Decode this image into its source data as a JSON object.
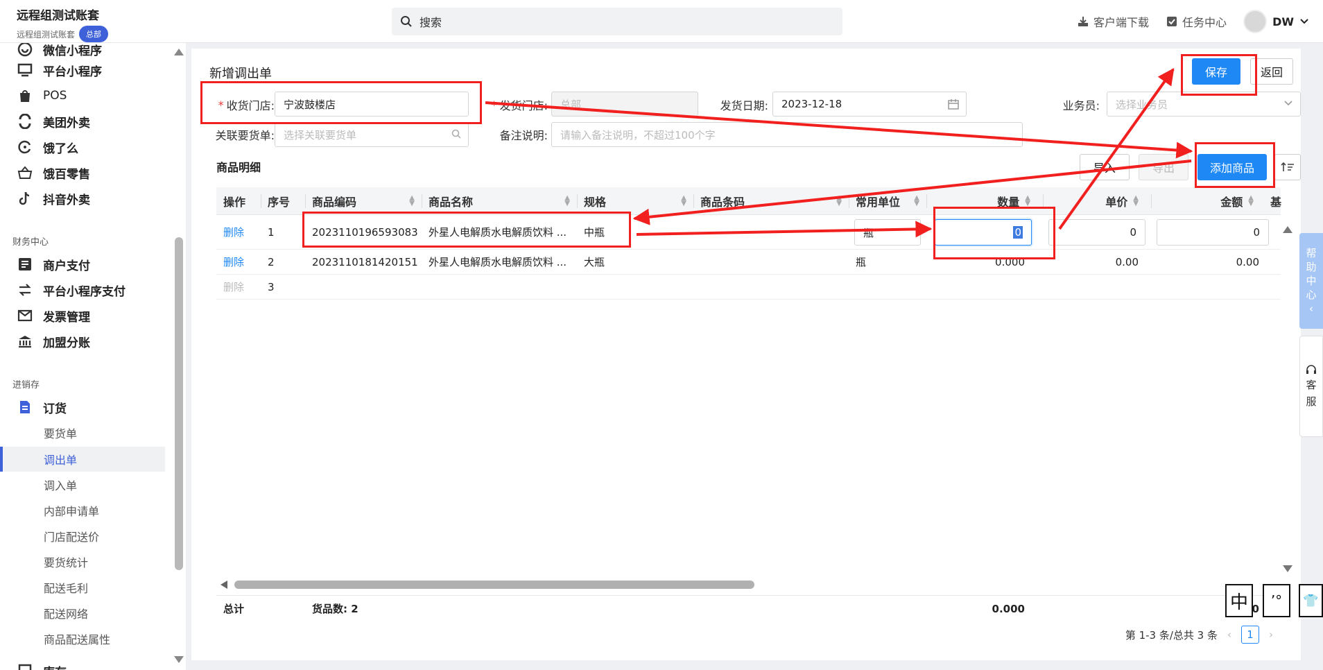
{
  "header": {
    "brand_title": "远程组测试账套",
    "brand_sub": "远程组测试账套",
    "brand_badge": "总部",
    "search_placeholder": "搜索",
    "client_download": "客户端下载",
    "task_center": "任务中心",
    "user": "DW"
  },
  "sidebar": {
    "top_items": [
      {
        "label": "微信小程序",
        "icon": "wechat-miniapp-icon"
      },
      {
        "label": "平台小程序",
        "icon": "platform-miniapp-icon"
      },
      {
        "label": "POS",
        "icon": "pos-bag-icon"
      },
      {
        "label": "美团外卖",
        "icon": "meituan-icon"
      },
      {
        "label": "饿了么",
        "icon": "eleme-icon"
      },
      {
        "label": "饿百零售",
        "icon": "basket-icon"
      },
      {
        "label": "抖音外卖",
        "icon": "douyin-icon"
      }
    ],
    "finance_label": "财务中心",
    "finance_items": [
      {
        "label": "商户支付",
        "icon": "list-icon"
      },
      {
        "label": "平台小程序支付",
        "icon": "exchange-icon"
      },
      {
        "label": "发票管理",
        "icon": "invoice-icon"
      },
      {
        "label": "加盟分账",
        "icon": "bank-icon"
      }
    ],
    "inventory_label": "进销存",
    "order_group": "订货",
    "order_items": [
      "要货单",
      "调出单",
      "调入单",
      "内部申请单",
      "门店配送价",
      "要货统计",
      "配送毛利",
      "配送网络",
      "商品配送属性"
    ],
    "active_item": "调出单",
    "bottom_item": "库存"
  },
  "page": {
    "title": "新增调出单",
    "save": "保存",
    "back": "返回",
    "form": {
      "receive_store_label": "收货门店:",
      "receive_store_value": "宁波鼓楼店",
      "send_store_label": "发货门店:",
      "send_store_value": "总部",
      "send_date_label": "发货日期:",
      "send_date_value": "2023-12-18",
      "salesman_label": "业务员:",
      "salesman_placeholder": "选择业务员",
      "related_order_label": "关联要货单:",
      "related_order_placeholder": "选择关联要货单",
      "remark_label": "备注说明:",
      "remark_placeholder": "请输入备注说明，不超过100个字"
    },
    "detail_title": "商品明细",
    "import": "导入",
    "export": "导出",
    "add_goods": "添加商品",
    "columns": [
      "操作",
      "序号",
      "商品编码",
      "商品名称",
      "规格",
      "商品条码",
      "常用单位",
      "数量",
      "单价",
      "金额",
      "基"
    ],
    "rows": [
      {
        "action": "删除",
        "no": "1",
        "code": "2023110196593083",
        "name": "外星人电解质水电解质饮料 ...",
        "spec": "中瓶",
        "barcode": "",
        "unit": "瓶",
        "qty": "0",
        "price": "0",
        "amount": "0"
      },
      {
        "action": "删除",
        "no": "2",
        "code": "2023110181420151",
        "name": "外星人电解质水电解质饮料 ...",
        "spec": "大瓶",
        "barcode": "",
        "unit": "瓶",
        "qty": "0.000",
        "price": "0.00",
        "amount": "0.00"
      },
      {
        "action": "删除",
        "no": "3",
        "code": "",
        "name": "",
        "spec": "",
        "barcode": "",
        "unit": "",
        "qty": "",
        "price": "",
        "amount": ""
      }
    ],
    "total_label": "总计",
    "goods_count_label": "货品数:",
    "goods_count": "2",
    "total_qty": "0.000",
    "total_amount_partial": ".0",
    "pager_text": "第 1-3 条/总共 3 条",
    "current_page": "1"
  },
  "float": {
    "help": [
      "帮",
      "助",
      "中",
      "心",
      "‹"
    ],
    "service": [
      "客",
      "服"
    ]
  },
  "ime": [
    "中",
    "’°",
    "👕"
  ],
  "colors": {
    "primary": "#1e88f5",
    "annotation": "#f21f1f",
    "brand": "#3e60d8"
  }
}
